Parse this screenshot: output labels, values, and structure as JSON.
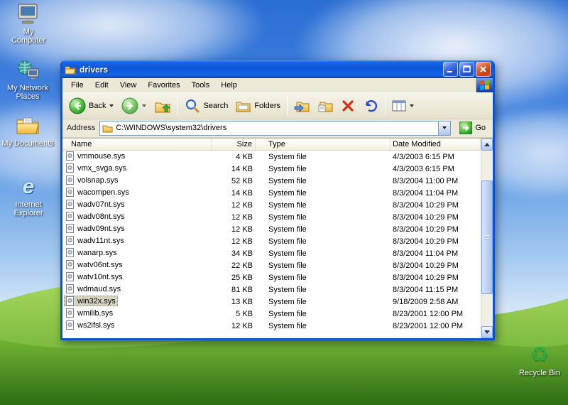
{
  "desktop": {
    "icons": {
      "my_computer": "My Computer",
      "my_network": "My Network Places",
      "my_documents": "My Documents",
      "internet_explorer": "Internet Explorer",
      "recycle_bin": "Recycle Bin"
    },
    "icon_glyphs": {
      "ie_glyph": "e",
      "recycle_glyph": "♻"
    }
  },
  "window": {
    "title": "drivers",
    "menu_items": [
      "File",
      "Edit",
      "View",
      "Favorites",
      "Tools",
      "Help"
    ],
    "toolbar": {
      "back_label": "Back",
      "search_label": "Search",
      "folders_label": "Folders"
    },
    "address_bar": {
      "label": "Address",
      "value": "C:\\WINDOWS\\system32\\drivers",
      "go_label": "Go"
    },
    "file_list": {
      "columns": [
        "Name",
        "Size",
        "Type",
        "Date Modified"
      ],
      "selected": "win32x.sys",
      "files": [
        {
          "name": "vmmouse.sys",
          "size": "4 KB",
          "type": "System file",
          "modified": "4/3/2003 6:15 PM"
        },
        {
          "name": "vmx_svga.sys",
          "size": "14 KB",
          "type": "System file",
          "modified": "4/3/2003 6:15 PM"
        },
        {
          "name": "volsnap.sys",
          "size": "52 KB",
          "type": "System file",
          "modified": "8/3/2004 11:00 PM"
        },
        {
          "name": "wacompen.sys",
          "size": "14 KB",
          "type": "System file",
          "modified": "8/3/2004 11:04 PM"
        },
        {
          "name": "wadv07nt.sys",
          "size": "12 KB",
          "type": "System file",
          "modified": "8/3/2004 10:29 PM"
        },
        {
          "name": "wadv08nt.sys",
          "size": "12 KB",
          "type": "System file",
          "modified": "8/3/2004 10:29 PM"
        },
        {
          "name": "wadv09nt.sys",
          "size": "12 KB",
          "type": "System file",
          "modified": "8/3/2004 10:29 PM"
        },
        {
          "name": "wadv11nt.sys",
          "size": "12 KB",
          "type": "System file",
          "modified": "8/3/2004 10:29 PM"
        },
        {
          "name": "wanarp.sys",
          "size": "34 KB",
          "type": "System file",
          "modified": "8/3/2004 11:04 PM"
        },
        {
          "name": "watv06nt.sys",
          "size": "22 KB",
          "type": "System file",
          "modified": "8/3/2004 10:29 PM"
        },
        {
          "name": "watv10nt.sys",
          "size": "25 KB",
          "type": "System file",
          "modified": "8/3/2004 10:29 PM"
        },
        {
          "name": "wdmaud.sys",
          "size": "81 KB",
          "type": "System file",
          "modified": "8/3/2004 11:15 PM"
        },
        {
          "name": "win32x.sys",
          "size": "13 KB",
          "type": "System file",
          "modified": "9/18/2009 2:58 AM"
        },
        {
          "name": "wmilib.sys",
          "size": "5 KB",
          "type": "System file",
          "modified": "8/23/2001 12:00 PM"
        },
        {
          "name": "ws2ifsl.sys",
          "size": "12 KB",
          "type": "System file",
          "modified": "8/23/2001 12:00 PM"
        }
      ]
    }
  },
  "colors": {
    "titlebar_blue": "#0b54d0",
    "close_red": "#c83a14",
    "selection_inactive": "#d7d3c3",
    "sky_top": "#2a6ed2",
    "grass_green": "#6fb52f"
  }
}
